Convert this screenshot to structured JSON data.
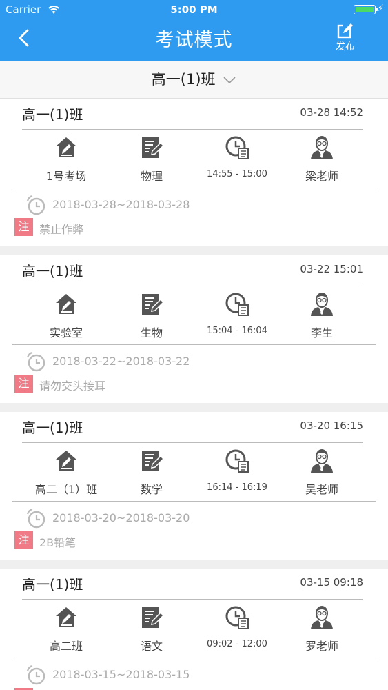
{
  "status": {
    "carrier": "Carrier",
    "time": "5:00 PM"
  },
  "nav": {
    "title": "考试模式",
    "publish_label": "发布"
  },
  "selector": {
    "class_name": "高一(1)班"
  },
  "exams": [
    {
      "class_name": "高一(1)班",
      "date": "03-28 14:52",
      "room": "1号考场",
      "subject": "物理",
      "time_span": "14:55 - 15:00",
      "teacher": "梁老师",
      "range": "2018-03-28~2018-03-28",
      "note_badge": "注",
      "note": "禁止作弊"
    },
    {
      "class_name": "高一(1)班",
      "date": "03-22 15:01",
      "room": "实验室",
      "subject": "生物",
      "time_span": "15:04 - 16:04",
      "teacher": "李生",
      "range": "2018-03-22~2018-03-22",
      "note_badge": "注",
      "note": "请勿交头接耳"
    },
    {
      "class_name": "高一(1)班",
      "date": "03-20 16:15",
      "room": "高二（1）班",
      "subject": "数学",
      "time_span": "16:14 - 16:19",
      "teacher": "吴老师",
      "range": "2018-03-20~2018-03-20",
      "note_badge": "注",
      "note": "2B铅笔"
    },
    {
      "class_name": "高一(1)班",
      "date": "03-15 09:18",
      "room": "高二班",
      "subject": "语文",
      "time_span": "09:02 - 12:00",
      "teacher": "罗老师",
      "range": "2018-03-15~2018-03-15",
      "note_badge": "注",
      "note": ""
    }
  ],
  "colors": {
    "primary": "#2f9bf0",
    "note_badge": "#f07a86",
    "icon": "#555555",
    "muted_text": "#aaaaaa"
  }
}
